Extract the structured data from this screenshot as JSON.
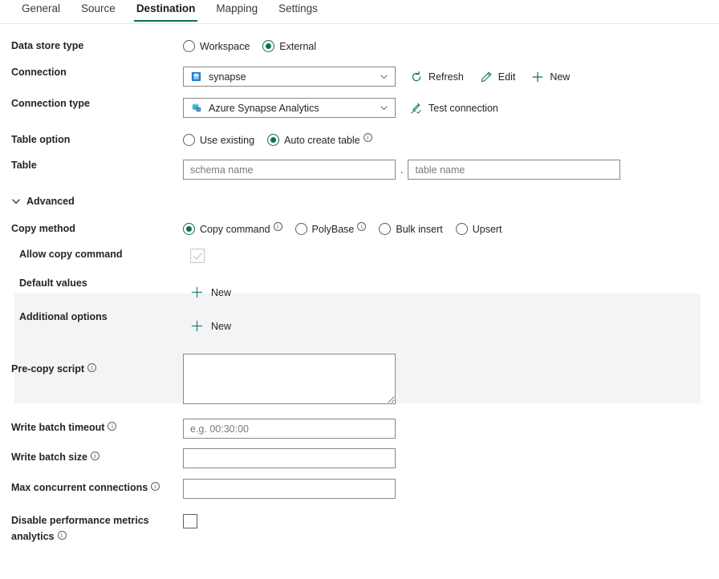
{
  "tabs": [
    {
      "label": "General",
      "active": false
    },
    {
      "label": "Source",
      "active": false
    },
    {
      "label": "Destination",
      "active": true
    },
    {
      "label": "Mapping",
      "active": false
    },
    {
      "label": "Settings",
      "active": false
    }
  ],
  "accent": "#0e6e57",
  "panel_bg": "#f3f4f6",
  "fields": {
    "data_store_type": {
      "label": "Data store type",
      "options": [
        {
          "label": "Workspace",
          "selected": false
        },
        {
          "label": "External",
          "selected": true
        }
      ]
    },
    "connection": {
      "label": "Connection",
      "value": "synapse",
      "icon": "sql-database-icon",
      "commands": [
        {
          "label": "Refresh",
          "icon": "refresh-icon"
        },
        {
          "label": "Edit",
          "icon": "pencil-icon"
        },
        {
          "label": "New",
          "icon": "plus-icon"
        }
      ]
    },
    "connection_type": {
      "label": "Connection type",
      "value": "Azure Synapse Analytics",
      "icon": "azure-synapse-icon",
      "command": {
        "label": "Test connection",
        "icon": "plug-check-icon"
      }
    },
    "table_option": {
      "label": "Table option",
      "options": [
        {
          "label": "Use existing",
          "selected": false,
          "info": false
        },
        {
          "label": "Auto create table",
          "selected": true,
          "info": true
        }
      ]
    },
    "table": {
      "label": "Table",
      "schema_placeholder": "schema name",
      "schema_value": "",
      "separator": ".",
      "table_placeholder": "table name",
      "table_value": ""
    },
    "advanced": {
      "label": "Advanced",
      "expanded": true,
      "icon": "chevron-down-icon"
    },
    "copy_method": {
      "label": "Copy method",
      "options": [
        {
          "label": "Copy command",
          "selected": true,
          "info": true
        },
        {
          "label": "PolyBase",
          "selected": false,
          "info": true
        },
        {
          "label": "Bulk insert",
          "selected": false,
          "info": false
        },
        {
          "label": "Upsert",
          "selected": false,
          "info": false
        }
      ]
    },
    "allow_copy_command": {
      "label": "Allow copy command",
      "checked": true,
      "disabled": true
    },
    "default_values": {
      "label": "Default values",
      "new_label": "New"
    },
    "additional_options": {
      "label": "Additional options",
      "new_label": "New"
    },
    "pre_copy_script": {
      "label": "Pre-copy script",
      "info": true,
      "value": "",
      "placeholder": ""
    },
    "write_batch_timeout": {
      "label": "Write batch timeout",
      "info": true,
      "value": "",
      "placeholder": "e.g. 00:30:00"
    },
    "write_batch_size": {
      "label": "Write batch size",
      "info": true,
      "value": "",
      "placeholder": ""
    },
    "max_concurrent_connections": {
      "label": "Max concurrent connections",
      "info": true,
      "value": "",
      "placeholder": ""
    },
    "disable_perf_metrics": {
      "label": "Disable performance metrics analytics",
      "info": true,
      "checked": false
    }
  }
}
